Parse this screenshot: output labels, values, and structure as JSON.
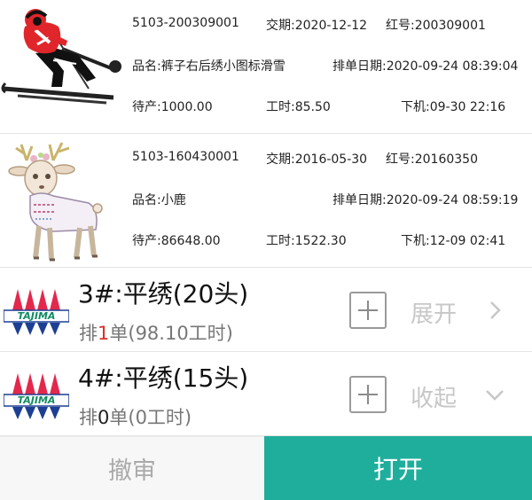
{
  "orders": [
    {
      "image_icon": "skier-embroidery-icon",
      "code": "5103-200309001",
      "delivery": "交期:2020-12-12",
      "red_no": "红号:200309001",
      "product_name": "品名:裤子右后绣小图标滑雪",
      "schedule_date": "排单日期:2020-09-24 08:39:04",
      "pending": "待产:1000.00",
      "work_hours": "工时:85.50",
      "off_machine": "下机:09-30 22:16"
    },
    {
      "image_icon": "deer-embroidery-icon",
      "code": "5103-160430001",
      "delivery": "交期:2016-05-30",
      "red_no": "红号:20160350",
      "product_name": "品名:小鹿",
      "schedule_date": "排单日期:2020-09-24 08:59:19",
      "pending": "待产:86648.00",
      "work_hours": "工时:1522.30",
      "off_machine": "下机:12-09 02:41"
    }
  ],
  "machines": [
    {
      "logo": "tajima-logo",
      "logo_text": "TAJIMA",
      "title": "3#:平绣(20头)",
      "sub_prefix": "排",
      "sub_count": "1",
      "sub_count_color": "#d9302c",
      "sub_suffix": "单(98.10工时)",
      "toggle_label": "展开",
      "toggle_icon": "chevron-right-icon"
    },
    {
      "logo": "tajima-logo",
      "logo_text": "TAJIMA",
      "title": "4#:平绣(15头)",
      "sub_prefix": "排",
      "sub_count": "0",
      "sub_count_color": "#222222",
      "sub_suffix": "单(0工时)",
      "toggle_label": "收起",
      "toggle_icon": "chevron-down-icon"
    }
  ],
  "actions": {
    "revoke_label": "撤审",
    "open_label": "打开"
  },
  "colors": {
    "primary": "#1fae9c",
    "highlight_red": "#d9302c",
    "tajima_red": "#e3284c",
    "tajima_blue": "#1c3f94",
    "tajima_green": "#0f8a5f"
  }
}
